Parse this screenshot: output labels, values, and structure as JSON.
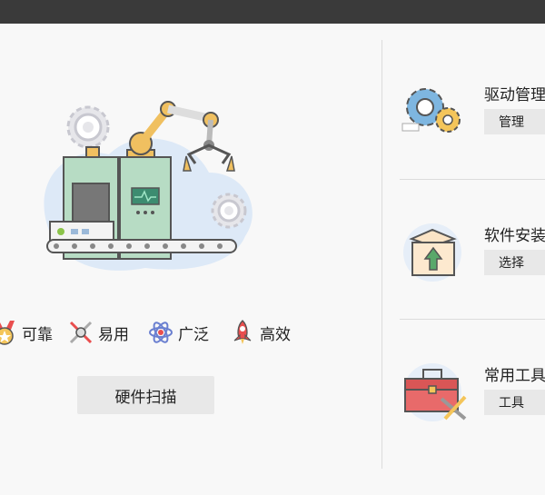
{
  "colors": {
    "titlebar": "#3a3a3a",
    "background": "#f8f8f8",
    "button": "#e8e8e8",
    "divider": "#dcdcdc"
  },
  "hero": {
    "icon": "factory-robot-arm-illustration"
  },
  "features": [
    {
      "label": "可靠",
      "icon": "medal-icon"
    },
    {
      "label": "易用",
      "icon": "tools-cross-icon"
    },
    {
      "label": "广泛",
      "icon": "atom-icon"
    },
    {
      "label": "高效",
      "icon": "rocket-icon"
    }
  ],
  "scan_button": {
    "label": "硬件扫描"
  },
  "tools": [
    {
      "name": "驱动管理",
      "button": "管理",
      "icon": "gears-icon"
    },
    {
      "name": "软件安装",
      "button": "选择",
      "icon": "box-upload-icon"
    },
    {
      "name": "常用工具",
      "button": "工具",
      "icon": "toolbox-icon"
    }
  ]
}
